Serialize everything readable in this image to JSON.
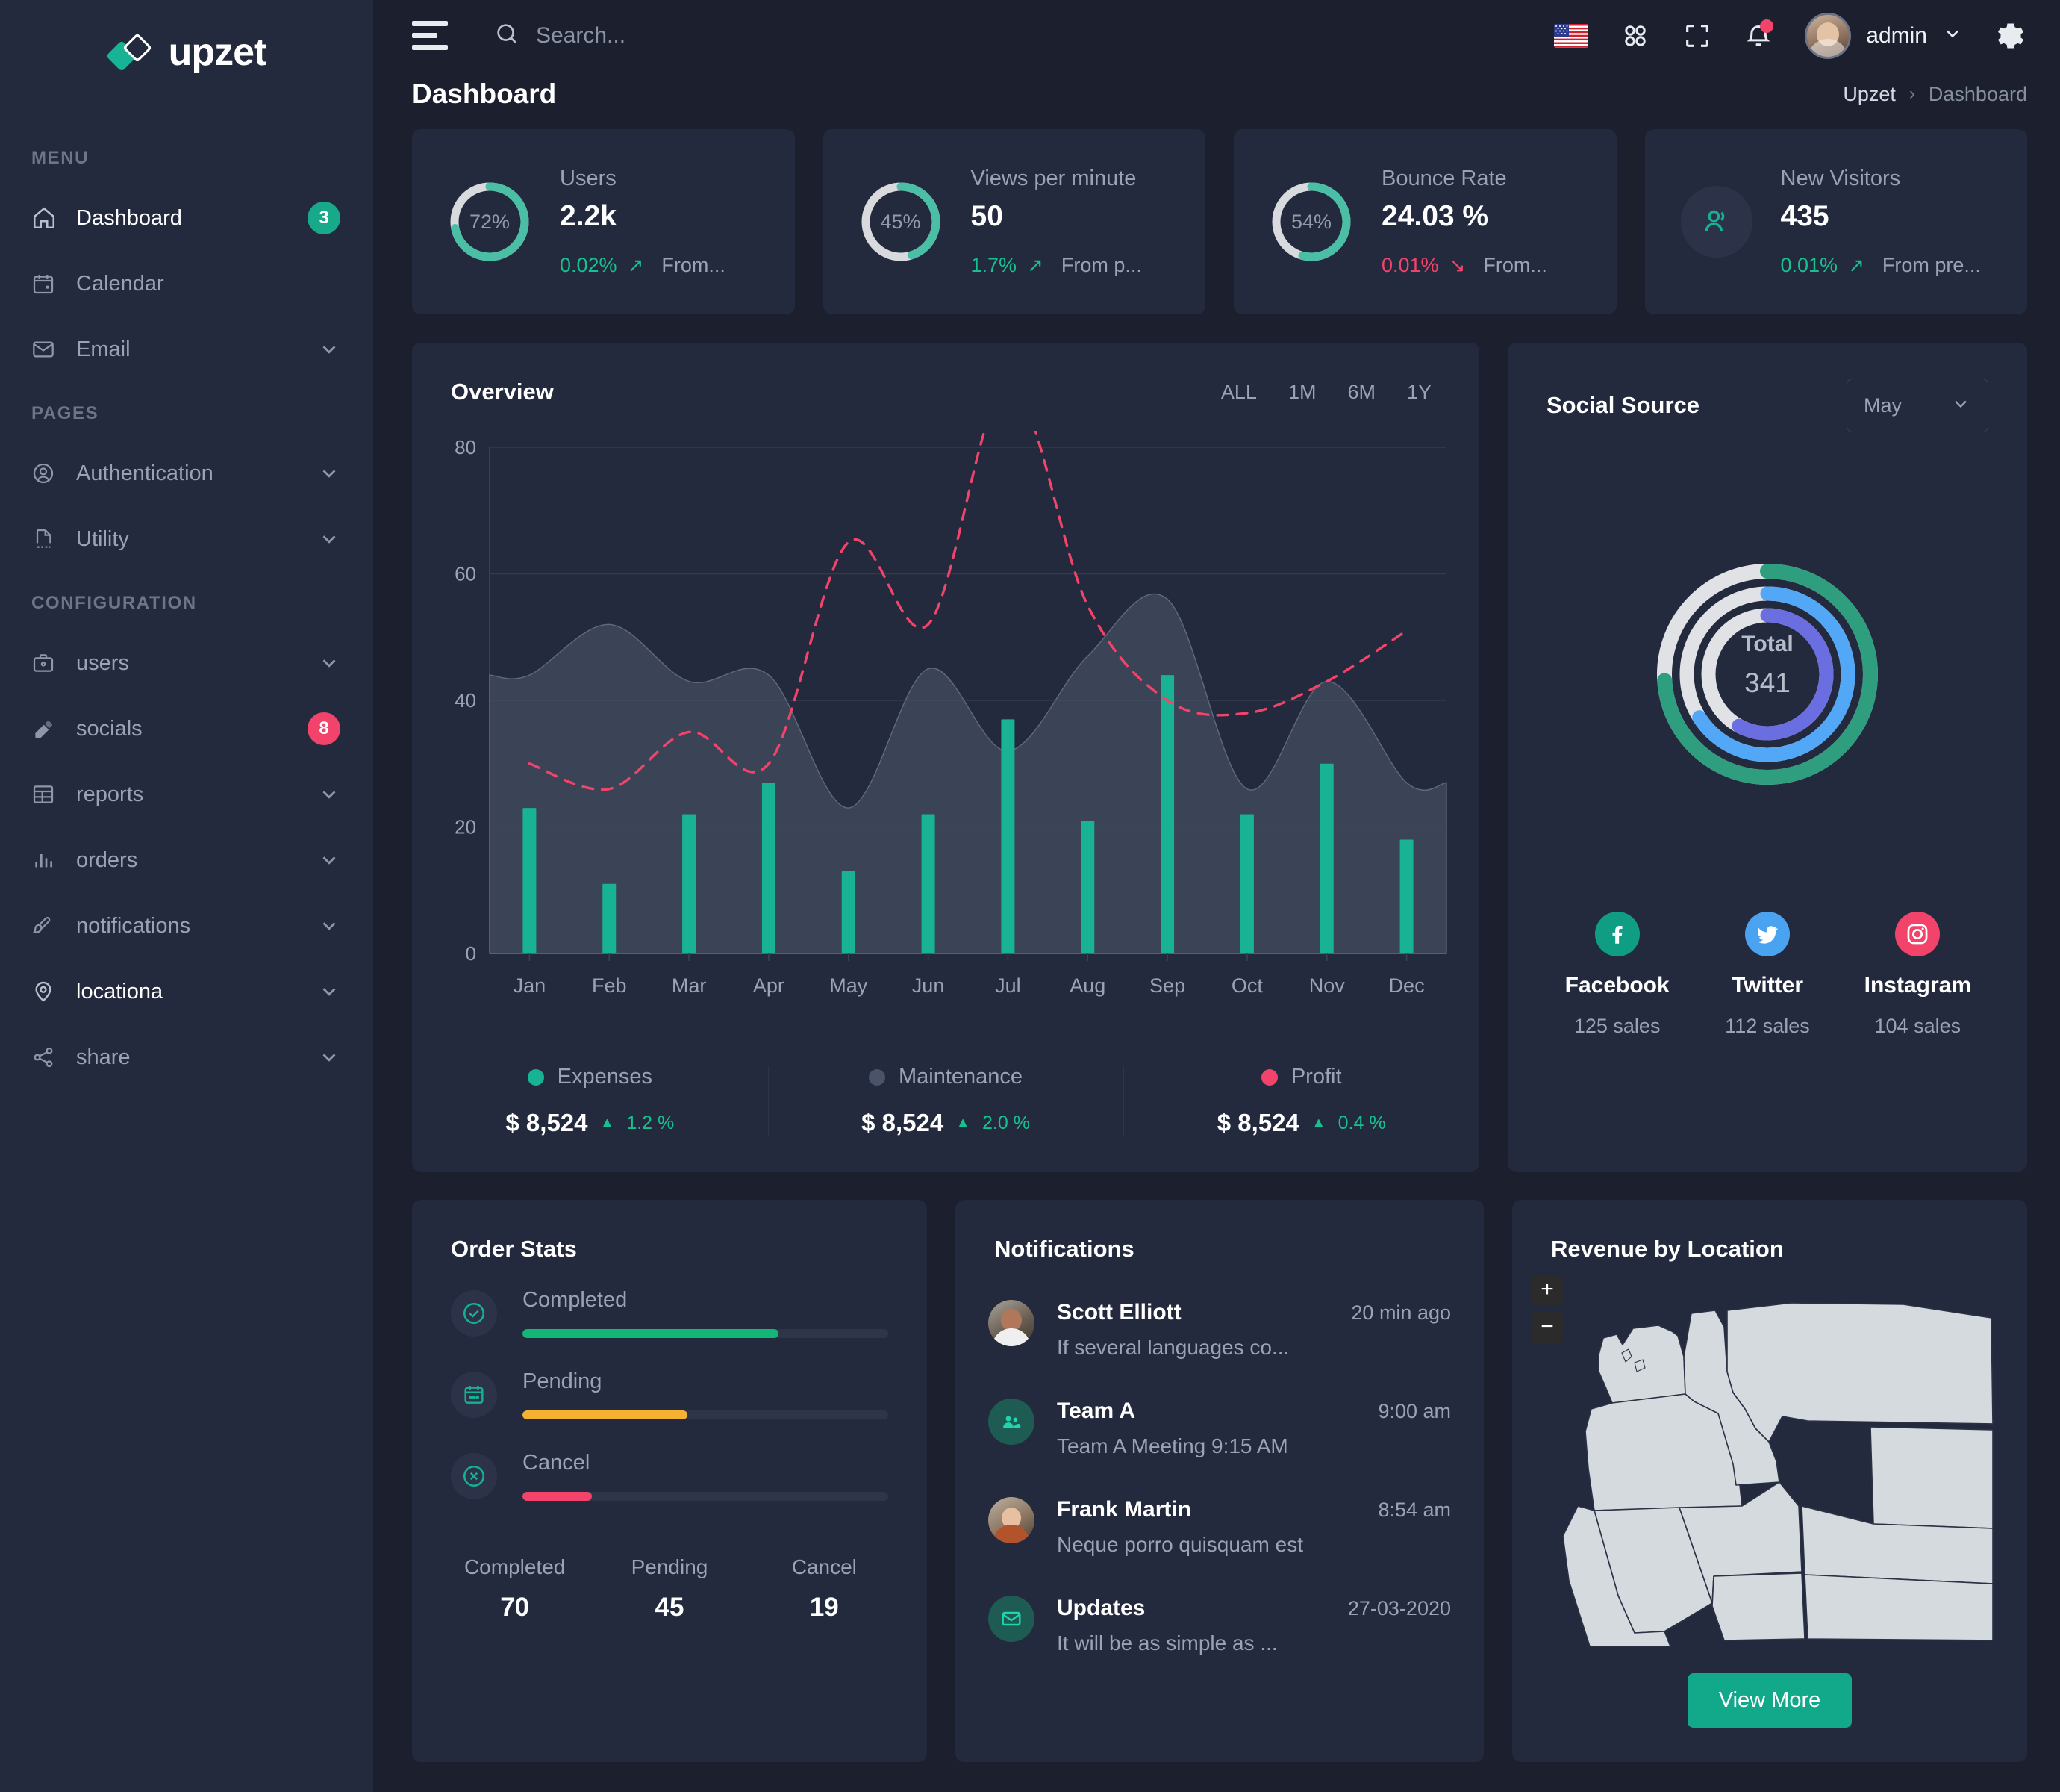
{
  "brand": {
    "name": "upzet"
  },
  "sidebar": {
    "sections": [
      {
        "title": "MENU"
      },
      {
        "title": "PAGES"
      },
      {
        "title": "CONFIGURATION"
      }
    ],
    "items": [
      {
        "label": "Dashboard",
        "icon": "home-icon",
        "badge": "3",
        "badge_color": "#17a98a",
        "active": true,
        "chevron": false
      },
      {
        "label": "Calendar",
        "icon": "calendar-icon",
        "badge": "",
        "active": false,
        "chevron": false
      },
      {
        "label": "Email",
        "icon": "mail-icon",
        "badge": "",
        "active": false,
        "chevron": true
      },
      {
        "label": "Authentication",
        "icon": "user-circle-icon",
        "badge": "",
        "active": false,
        "chevron": true
      },
      {
        "label": "Utility",
        "icon": "file-icon",
        "badge": "",
        "active": false,
        "chevron": true
      },
      {
        "label": "users",
        "icon": "briefcase-icon",
        "badge": "",
        "active": false,
        "chevron": true
      },
      {
        "label": "socials",
        "icon": "eraser-icon",
        "badge": "8",
        "badge_color": "#f2436a",
        "active": false,
        "chevron": false
      },
      {
        "label": "reports",
        "icon": "table-icon",
        "badge": "",
        "active": false,
        "chevron": true
      },
      {
        "label": "orders",
        "icon": "bar-chart-icon",
        "badge": "",
        "active": false,
        "chevron": true
      },
      {
        "label": "notifications",
        "icon": "brush-icon",
        "badge": "",
        "active": false,
        "chevron": true
      },
      {
        "label": "locationa",
        "icon": "map-pin-icon",
        "badge": "",
        "active": true,
        "chevron": true
      },
      {
        "label": "share",
        "icon": "share-icon",
        "badge": "",
        "active": false,
        "chevron": true
      }
    ]
  },
  "topbar": {
    "search_placeholder": "Search...",
    "search_value": "",
    "username": "admin",
    "flag": "us-flag-icon",
    "notification_dot": true
  },
  "pagehead": {
    "title": "Dashboard",
    "crumb_root": "Upzet",
    "crumb_sep": "›",
    "crumb_current": "Dashboard"
  },
  "stats": [
    {
      "title": "Users",
      "value": "2.2k",
      "ring_pct": 72,
      "ring_label": "72%",
      "delta": "0.02%",
      "direction": "up",
      "arrow": "↗",
      "from": "From...",
      "icon": "donut-ring"
    },
    {
      "title": "Views per minute",
      "value": "50",
      "ring_pct": 45,
      "ring_label": "45%",
      "delta": "1.7%",
      "direction": "up",
      "arrow": "↗",
      "from": "From p...",
      "icon": "donut-ring"
    },
    {
      "title": "Bounce Rate",
      "value": "24.03 %",
      "ring_pct": 54,
      "ring_label": "54%",
      "delta": "0.01%",
      "direction": "down",
      "arrow": "↘",
      "from": "From...",
      "icon": "donut-ring"
    },
    {
      "title": "New Visitors",
      "value": "435",
      "ring_pct": 0,
      "ring_label": "",
      "delta": "0.01%",
      "direction": "up",
      "arrow": "↗",
      "from": "From pre...",
      "icon": "users-icon"
    }
  ],
  "overview": {
    "title": "Overview",
    "ranges": [
      "ALL",
      "1M",
      "6M",
      "1Y"
    ],
    "legend": [
      {
        "name": "Expenses",
        "color": "#17b394",
        "amount": "$ 8,524",
        "pct": "1.2 %",
        "tri": "▲"
      },
      {
        "name": "Maintenance",
        "color": "#4a5368",
        "amount": "$ 8,524",
        "pct": "2.0 %",
        "tri": "▲"
      },
      {
        "name": "Profit",
        "color": "#f2436a",
        "amount": "$ 8,524",
        "pct": "0.4 %",
        "tri": "▲"
      }
    ]
  },
  "chart_data": {
    "type": "bar",
    "title": "Overview",
    "xlabel": "",
    "ylabel": "",
    "ylim": [
      0,
      80
    ],
    "yticks": [
      0,
      20,
      40,
      60,
      80
    ],
    "grid": true,
    "legend_position": "bottom",
    "categories": [
      "Jan",
      "Feb",
      "Mar",
      "Apr",
      "May",
      "Jun",
      "Jul",
      "Aug",
      "Sep",
      "Oct",
      "Nov",
      "Dec"
    ],
    "series": [
      {
        "name": "Expenses",
        "type": "bar",
        "color": "#17b394",
        "values": [
          23,
          11,
          22,
          27,
          13,
          22,
          37,
          21,
          44,
          22,
          30,
          18
        ]
      },
      {
        "name": "Maintenance",
        "type": "area",
        "color": "#4a5368",
        "values": [
          44,
          52,
          43,
          44,
          23,
          45,
          32,
          47,
          56,
          26,
          43,
          27
        ]
      },
      {
        "name": "Profit",
        "type": "line",
        "color": "#f2436a",
        "dashed": true,
        "values": [
          30,
          26,
          35,
          30,
          65,
          52,
          90,
          55,
          40,
          38,
          43,
          51
        ]
      }
    ]
  },
  "social": {
    "title": "Social Source",
    "month": "May",
    "total_label": "Total",
    "total_value": "341",
    "rings": [
      {
        "name": "Facebook",
        "color": "#2e9e7e",
        "pct": 74
      },
      {
        "name": "Twitter",
        "color": "#52a7f7",
        "pct": 66
      },
      {
        "name": "Instagram",
        "color": "#6b6ee0",
        "pct": 58
      }
    ],
    "platforms": [
      {
        "name": "Facebook",
        "sales": "125 sales",
        "color": "#0f9e83",
        "icon": "facebook-icon"
      },
      {
        "name": "Twitter",
        "sales": "112 sales",
        "color": "#4aa3f0",
        "icon": "twitter-icon"
      },
      {
        "name": "Instagram",
        "sales": "104 sales",
        "color": "#f2436a",
        "icon": "instagram-icon"
      }
    ]
  },
  "order_stats": {
    "title": "Order Stats",
    "items": [
      {
        "label": "Completed",
        "pct": 70,
        "color": "#13b675",
        "icon": "check-circle-icon"
      },
      {
        "label": "Pending",
        "pct": 45,
        "color": "#f5b132",
        "icon": "calendar-icon"
      },
      {
        "label": "Cancel",
        "pct": 19,
        "color": "#f2436a",
        "icon": "x-circle-icon"
      }
    ],
    "footer": [
      {
        "label": "Completed",
        "value": "70"
      },
      {
        "label": "Pending",
        "value": "45"
      },
      {
        "label": "Cancel",
        "value": "19"
      }
    ]
  },
  "notifications": {
    "title": "Notifications",
    "items": [
      {
        "name": "Scott Elliott",
        "time": "20 min ago",
        "message": "If several languages co...",
        "avatar": "photo-scott"
      },
      {
        "name": "Team A",
        "time": "9:00 am",
        "message": "Team A Meeting 9:15 AM",
        "avatar": "team-icon"
      },
      {
        "name": "Frank Martin",
        "time": "8:54 am",
        "message": "Neque porro quisquam est",
        "avatar": "photo-frank"
      },
      {
        "name": "Updates",
        "time": "27-03-2020",
        "message": "It will be as simple as ...",
        "avatar": "mail-icon"
      }
    ]
  },
  "revenue_map": {
    "title": "Revenue by Location",
    "zoom_in": "+",
    "zoom_out": "−",
    "view_more": "View More"
  },
  "colors": {
    "accent": "#17b394",
    "danger": "#f2436a",
    "warning": "#f5b132",
    "panel": "#242a3d",
    "bg": "#1b1f2e"
  }
}
